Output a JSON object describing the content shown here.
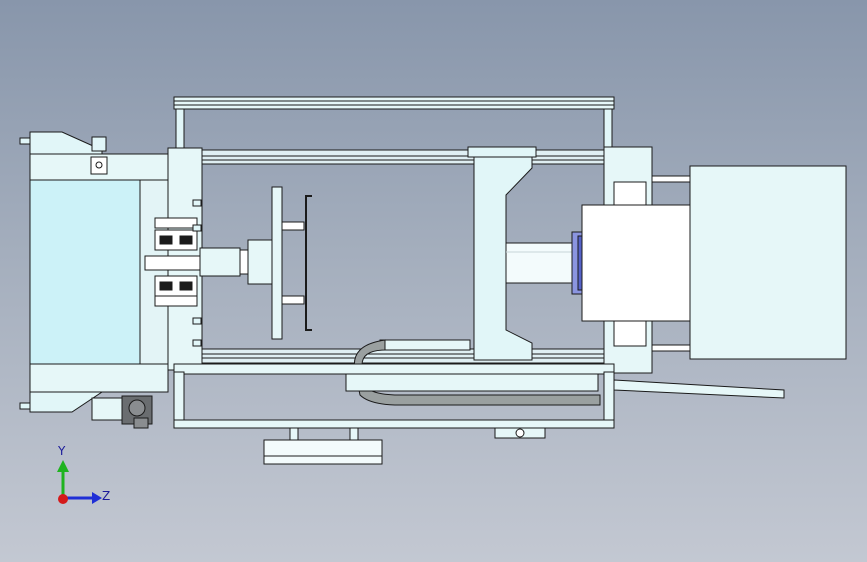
{
  "view": {
    "background_top": "#8896ab",
    "background_bottom": "#c3c8d2",
    "part_fill": "#e1f6f8",
    "part_stroke": "#1b1b1b"
  },
  "triad": {
    "y_label": "Y",
    "z_label": "Z",
    "y_color": "#1fb31f",
    "z_color": "#1f2fd6",
    "x_color": "#d41a1a"
  }
}
